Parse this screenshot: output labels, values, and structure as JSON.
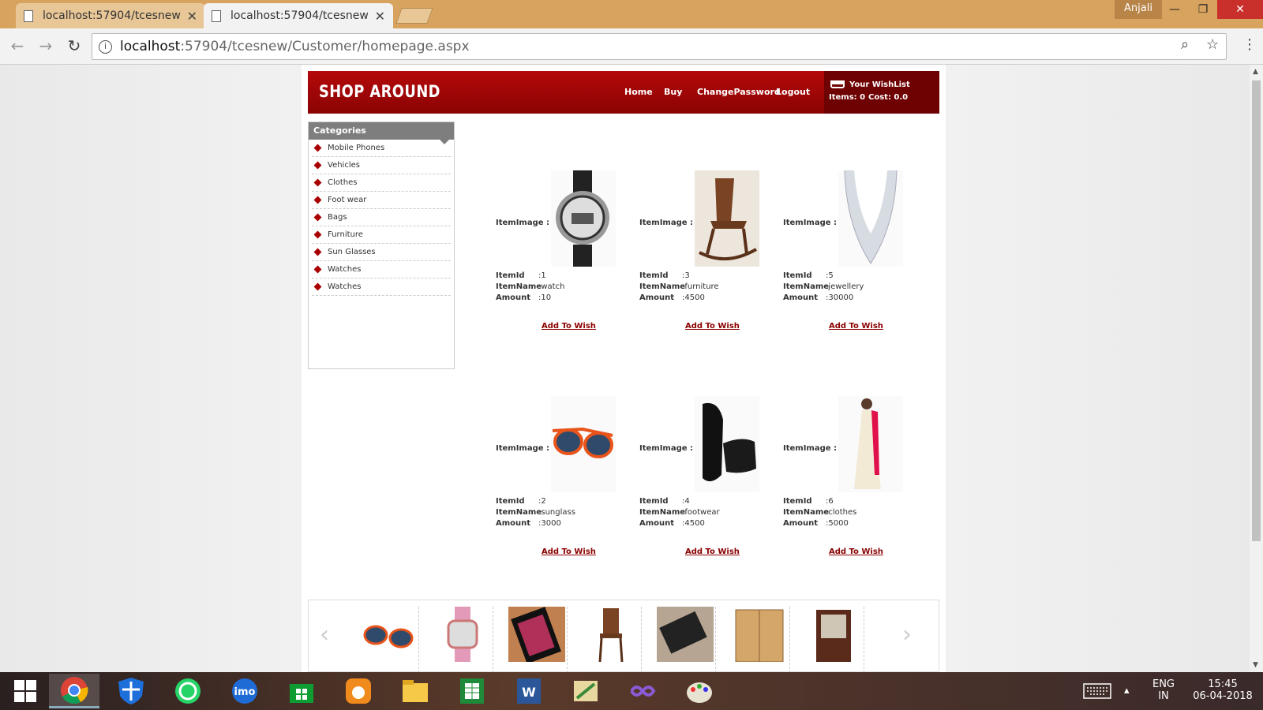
{
  "browser": {
    "tabs": [
      {
        "title": "localhost:57904/tcesnew/"
      },
      {
        "title": "localhost:57904/tcesnew/"
      }
    ],
    "user": "Anjali",
    "address": {
      "host": "localhost",
      "path": ":57904/tcesnew/Customer/homepage.aspx"
    }
  },
  "site": {
    "logo": "SHOP AROUND",
    "nav": [
      "Home",
      "Buy",
      "ChangePassword",
      "Logout"
    ],
    "wishlist": {
      "title": "Your WishList",
      "items": "Items: 0",
      "cost": "Cost: 0.0"
    }
  },
  "categories": {
    "title": "Categories",
    "items": [
      "Mobile Phones",
      "Vehicles",
      "Clothes",
      "Foot wear",
      "Bags",
      "Furniture",
      "Sun Glasses",
      "Watches",
      "Watches"
    ]
  },
  "labels": {
    "image": "ItemImage :",
    "id": "ItemId",
    "name": "ItemName",
    "amount": "Amount",
    "add": "Add To Wish"
  },
  "products": [
    {
      "id": ":1",
      "name": ":watch",
      "amount": ":10",
      "icon": "watch-image"
    },
    {
      "id": ":3",
      "name": ":furniture",
      "amount": ":4500",
      "icon": "rocking-chair-image"
    },
    {
      "id": ":5",
      "name": ":jewellery",
      "amount": ":30000",
      "icon": "necklace-image"
    },
    {
      "id": ":2",
      "name": ":sunglass",
      "amount": ":3000",
      "icon": "sunglasses-image"
    },
    {
      "id": ":4",
      "name": ":footwear",
      "amount": ":4500",
      "icon": "shoe-image"
    },
    {
      "id": ":6",
      "name": ":clothes",
      "amount": ":5000",
      "icon": "dress-image"
    }
  ],
  "carousel": [
    "sunglasses",
    "pink watch",
    "mobile phone",
    "chair",
    "tablet",
    "wardrobe",
    "cabinet"
  ],
  "taskbar": {
    "language": "ENG",
    "region": "IN",
    "time": "15:45",
    "date": "06-04-2018",
    "apps": [
      "start",
      "chrome",
      "defender",
      "whatsapp",
      "imo",
      "store",
      "uc-browser",
      "file-explorer",
      "excel",
      "word",
      "tool",
      "visual-studio",
      "paint"
    ]
  },
  "colors": {
    "brand": "#a00304",
    "link": "#8a0000"
  }
}
